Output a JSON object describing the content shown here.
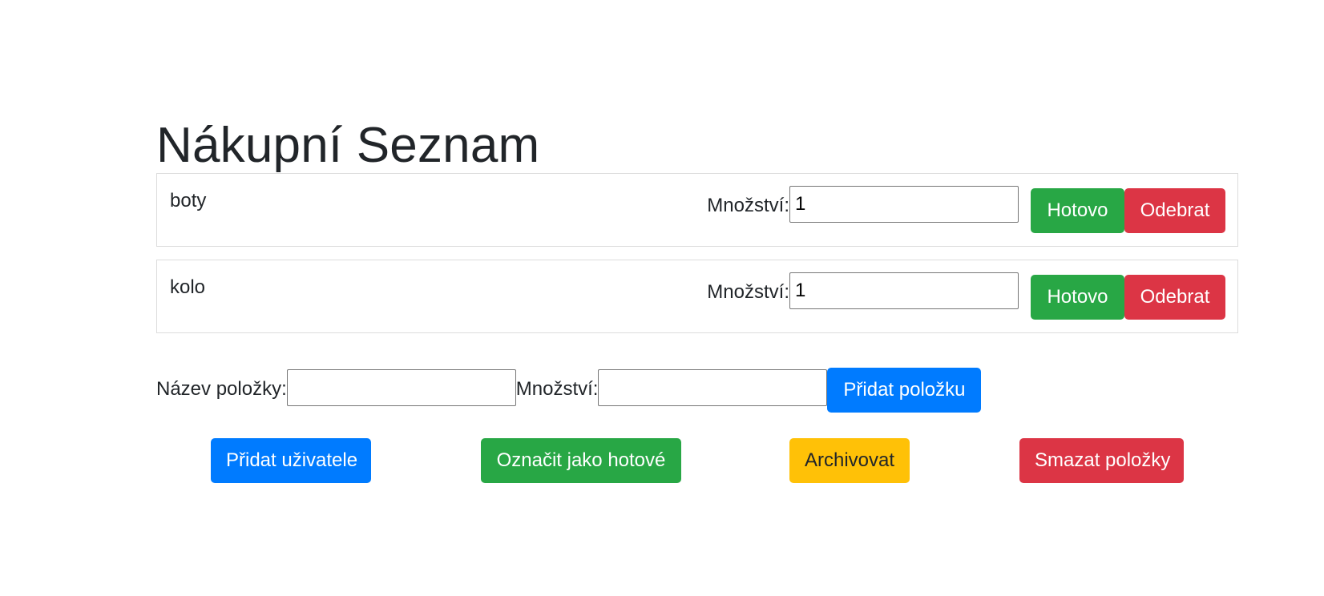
{
  "page": {
    "title": "Nákupní Seznam"
  },
  "items": [
    {
      "name": "boty",
      "quantity_label": "Množství:",
      "quantity_value": "1",
      "done_label": "Hotovo",
      "remove_label": "Odebrat"
    },
    {
      "name": "kolo",
      "quantity_label": "Množství:",
      "quantity_value": "1",
      "done_label": "Hotovo",
      "remove_label": "Odebrat"
    }
  ],
  "add_form": {
    "name_label": "Název položky:",
    "name_value": "",
    "quantity_label": "Množství:",
    "quantity_value": "",
    "add_button": "Přidat položku"
  },
  "actions": {
    "add_user": "Přidat uživatele",
    "mark_done": "Označit jako hotové",
    "archive": "Archivovat",
    "delete_items": "Smazat položky"
  },
  "colors": {
    "primary": "#007bff",
    "success": "#28a745",
    "danger": "#dc3545",
    "warning": "#ffc107"
  }
}
